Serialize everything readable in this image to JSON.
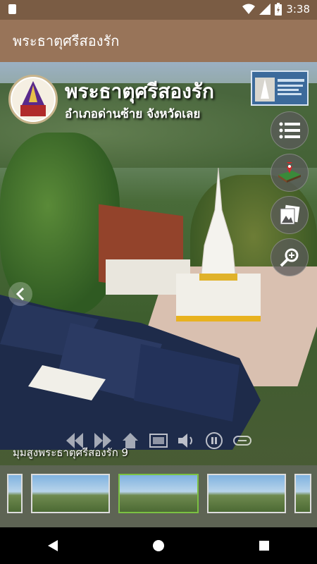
{
  "status_bar": {
    "time": "3:38",
    "icons": [
      "sim-card-icon",
      "wifi-icon",
      "signal-icon",
      "battery-charging-icon"
    ]
  },
  "app_bar": {
    "title": "พระธาตุศรีสองรัก"
  },
  "overlay": {
    "title": "พระธาตุศรีสองรัก",
    "subtitle": "อำเภอด่านซ้าย จังหวัดเลย"
  },
  "side_buttons": [
    "list-icon",
    "map-icon",
    "gallery-icon",
    "zoom-in-icon"
  ],
  "controls": [
    "rewind-icon",
    "fast-forward-icon",
    "home-icon",
    "slideshow-icon",
    "volume-icon",
    "autorotate-icon",
    "minimize-icon"
  ],
  "scene": {
    "label": "มุมสูงพระธาตุศรีสองรัก 9"
  },
  "thumbnails": {
    "count": 5,
    "active_index": 2
  },
  "nav": [
    "back-icon",
    "home-icon",
    "recents-icon"
  ]
}
